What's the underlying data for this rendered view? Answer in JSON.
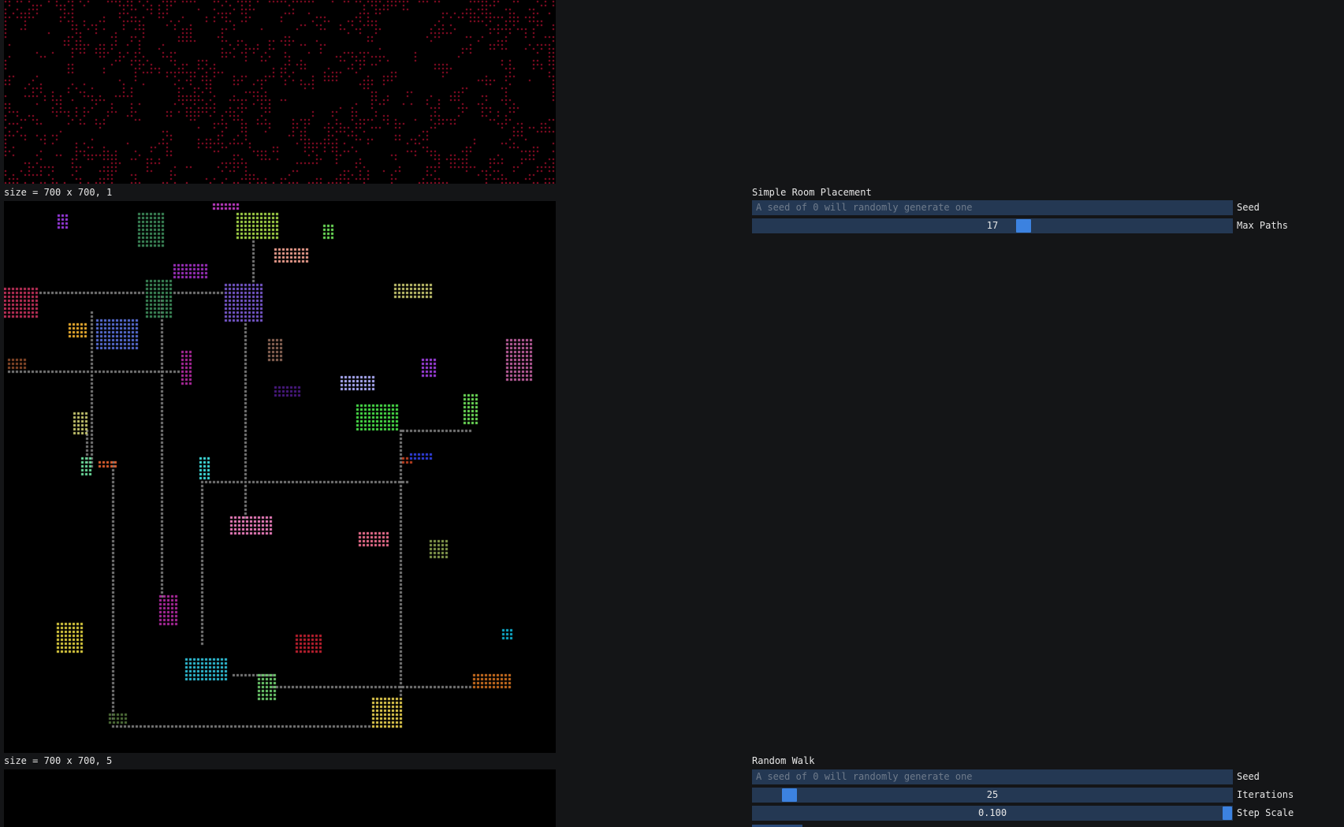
{
  "canvas1": {
    "size_label": "",
    "bg": "#000000",
    "dot_color": "#9b0e2a"
  },
  "canvas2": {
    "size_label": "size = 700 x 700, 1",
    "bg": "#000000",
    "corridor_color": "#7a7a7a"
  },
  "canvas3": {
    "size_label": "size = 700 x 700, 5",
    "bg": "#000000"
  },
  "simple_room": {
    "title": "Simple Room Placement",
    "seed": {
      "placeholder": "A seed of 0 will randomly generate one",
      "label": "Seed",
      "value": ""
    },
    "max_paths": {
      "value": "17",
      "label": "Max Paths",
      "fraction": 0.55
    }
  },
  "random_walk": {
    "title": "Random Walk",
    "seed": {
      "placeholder": "A seed of 0 will randomly generate one",
      "label": "Seed",
      "value": ""
    },
    "iterations": {
      "value": "25",
      "label": "Iterations",
      "fraction": 0.05
    },
    "step_scale": {
      "value": "0.100",
      "label": "Step Scale",
      "fraction": 1.0
    }
  },
  "colors": {
    "input_bg": "#243853",
    "slider_grab": "#3c82e0",
    "window_bg": "#141517"
  }
}
